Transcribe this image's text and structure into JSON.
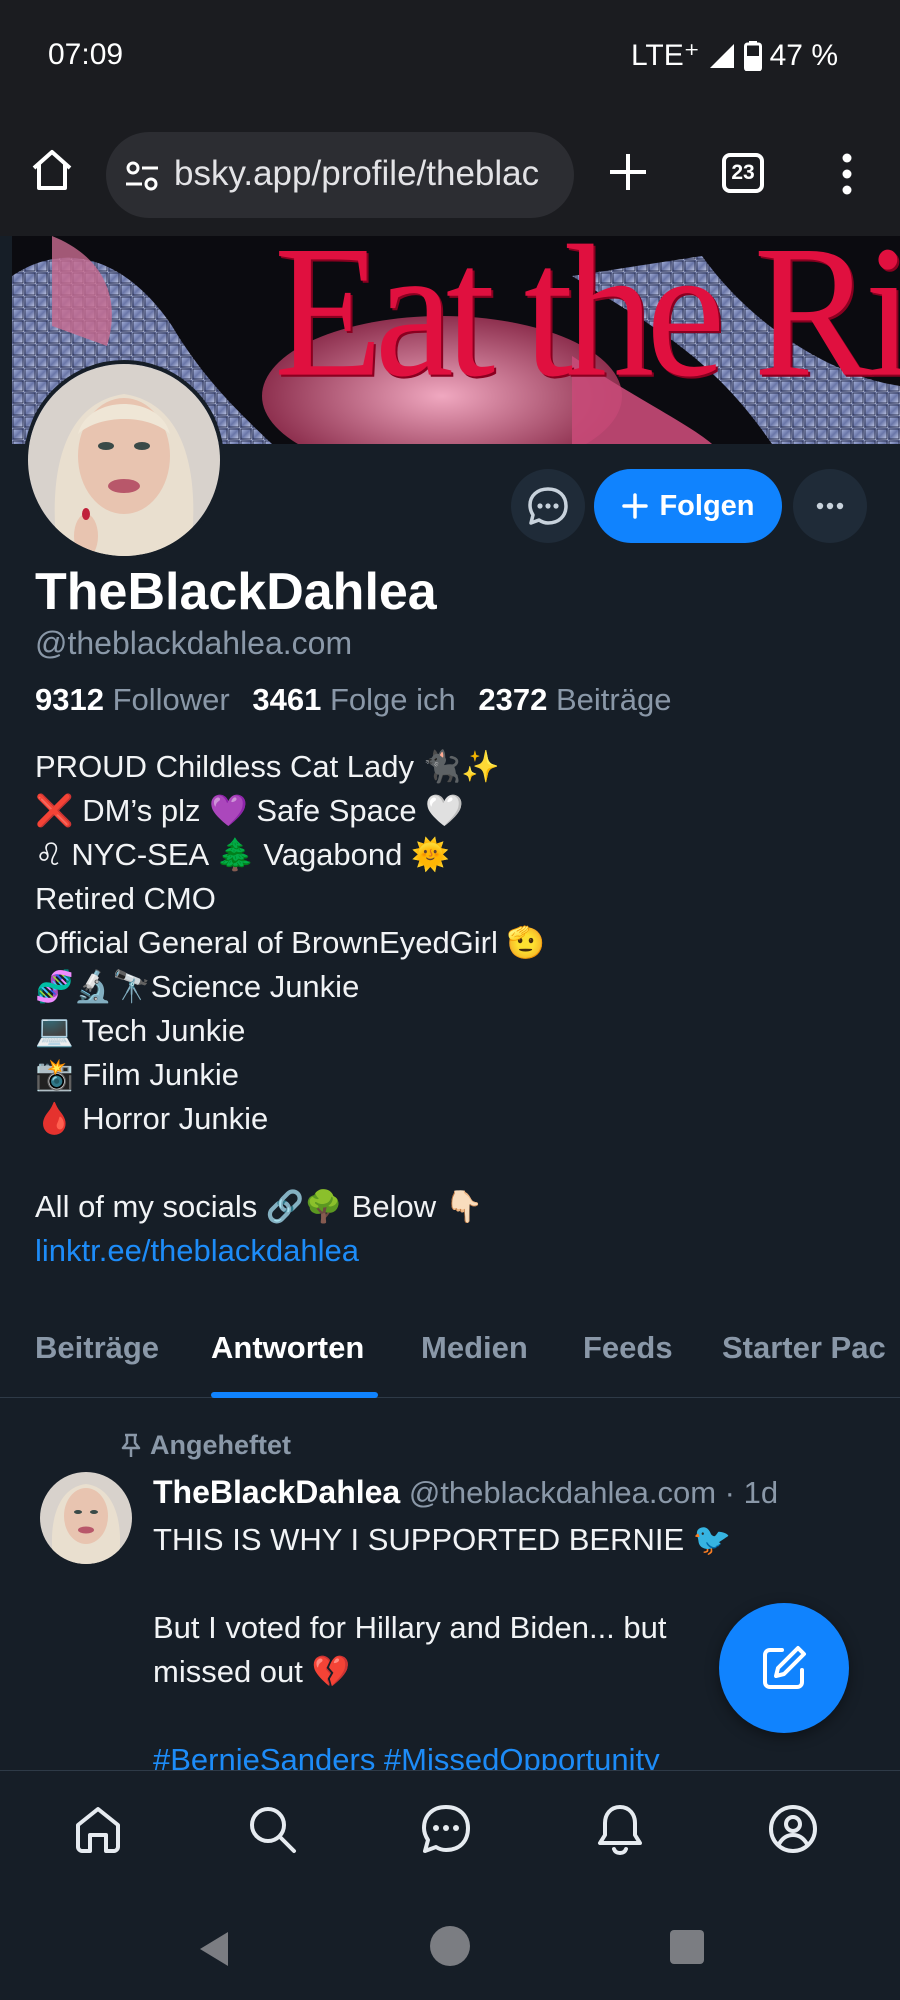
{
  "status_bar": {
    "time": "07:09",
    "network": "LTE⁺",
    "battery": "47 %"
  },
  "browser": {
    "url": "bsky.app/profile/theblac",
    "tab_count": "23"
  },
  "banner": {
    "text": "Eat the Rich"
  },
  "profile": {
    "display_name": "TheBlackDahlea",
    "handle": "@theblackdahlea.com",
    "follow_label": "Folgen",
    "stats": {
      "followers_count": "9312",
      "followers_label": "Follower",
      "following_count": "3461",
      "following_label": "Folge ich",
      "posts_count": "2372",
      "posts_label": "Beiträge"
    },
    "bio_lines": [
      "PROUD Childless Cat Lady 🐈‍⬛✨",
      "❌ DM’s plz 💜 Safe Space 🤍",
      "♌ NYC-SEA 🌲 Vagabond 🌞",
      "Retired CMO",
      "Official General of BrownEyedGirl 🫡",
      "🧬🔬🔭Science Junkie",
      "💻 Tech Junkie",
      "📸 Film Junkie",
      "🩸 Horror Junkie",
      "All of my socials 🔗🌳 Below 👇🏻"
    ],
    "bio_link": "linktr.ee/theblackdahlea"
  },
  "tabs": [
    "Beiträge",
    "Antworten",
    "Medien",
    "Feeds",
    "Starter Pac"
  ],
  "active_tab": "Antworten",
  "post": {
    "pinned_label": "Angeheftet",
    "author": "TheBlackDahlea",
    "meta": "@theblackdahlea.com · 1d",
    "lines": [
      "THIS IS WHY I SUPPORTED BERNIE 🐦",
      "But I voted for Hillary and Biden... but",
      "missed out 💔"
    ],
    "hashtags": "#BernieSanders #MissedOpportunity"
  },
  "colors": {
    "accent": "#1083fe",
    "background": "#161e27",
    "banner_text": "#e0103f"
  }
}
